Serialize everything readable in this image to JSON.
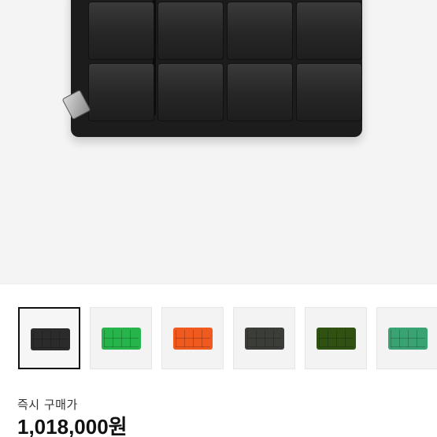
{
  "product_image": {
    "icon": "wallet-photo",
    "colors": {
      "body": "#1c1c1c",
      "background": "#f4f4f4"
    }
  },
  "thumbnails": [
    {
      "color_name": "black",
      "color": "#2b2b2b",
      "selected": true
    },
    {
      "color_name": "green",
      "color": "#27b44a",
      "selected": false
    },
    {
      "color_name": "orange",
      "color": "#f05a1e",
      "selected": false
    },
    {
      "color_name": "dark-gray",
      "color": "#3a3d38",
      "selected": false
    },
    {
      "color_name": "dark-green",
      "color": "#2f5212",
      "selected": false
    },
    {
      "color_name": "jade",
      "color": "#3aa374",
      "selected": false
    }
  ],
  "price": {
    "label": "즉시 구매가",
    "value": "1,018,000원"
  }
}
